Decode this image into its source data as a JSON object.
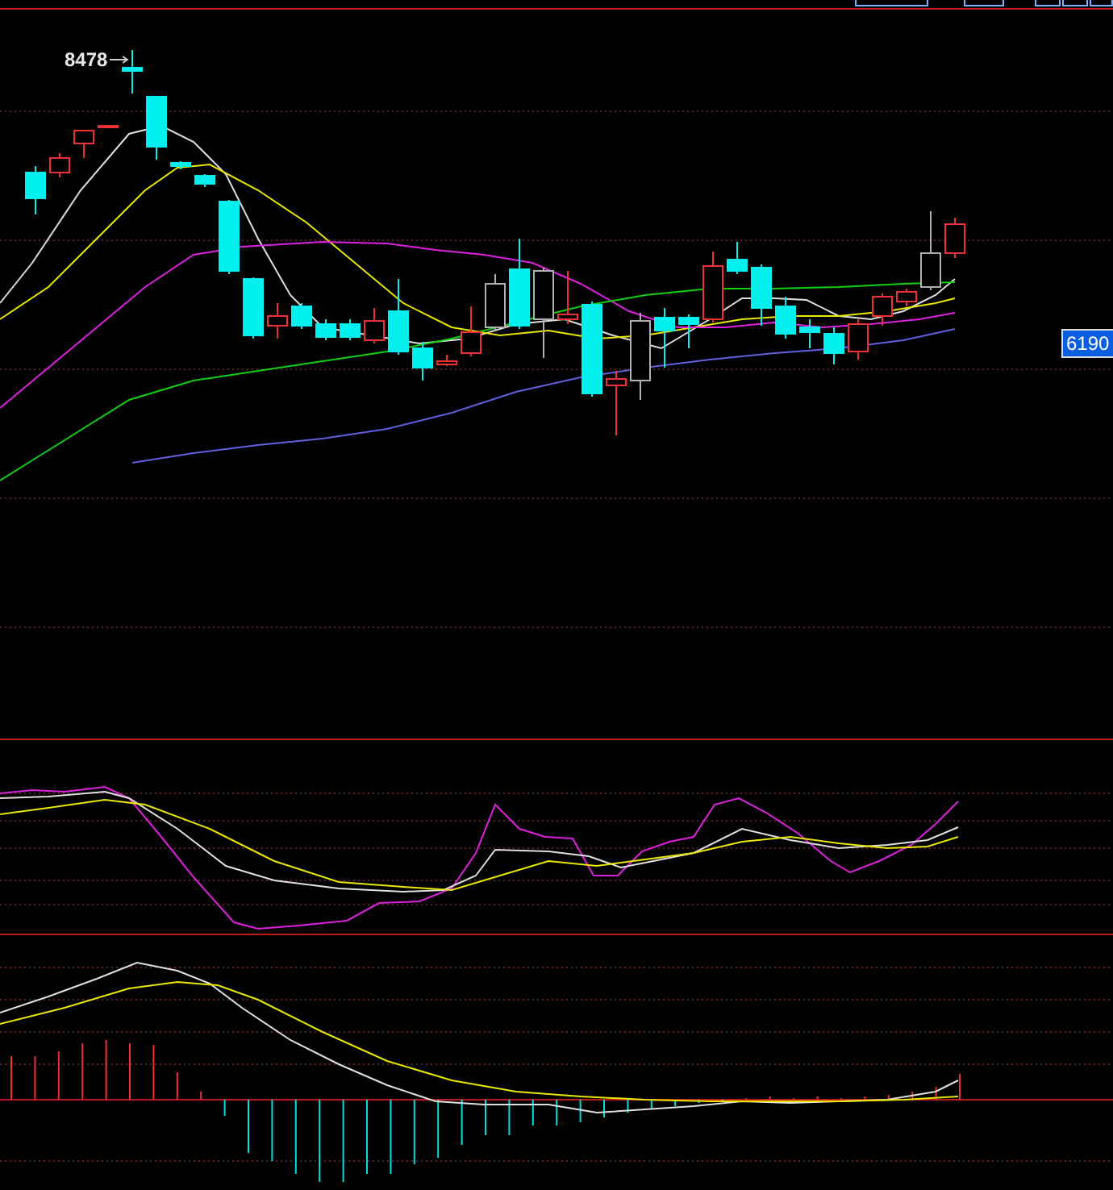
{
  "price_chart": {
    "high_label": "8478",
    "current_price": "6190"
  }
}
